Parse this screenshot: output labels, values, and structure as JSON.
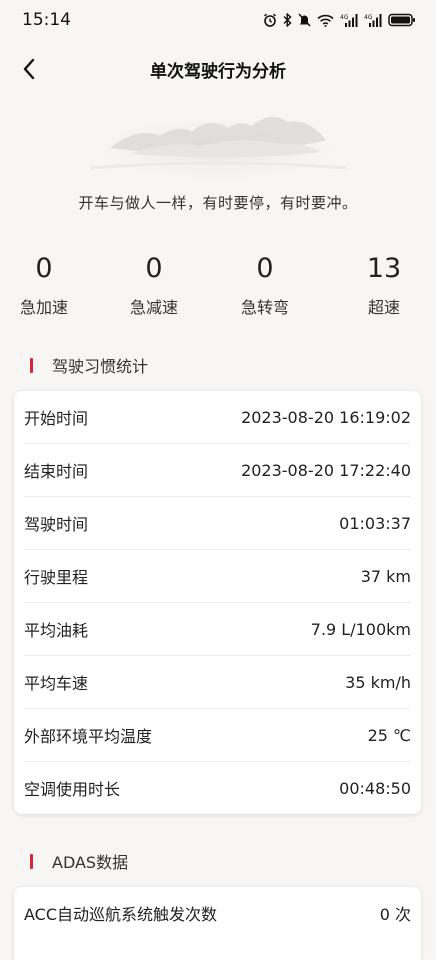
{
  "status_bar": {
    "time": "15:14",
    "icons": [
      "alarm-icon",
      "bluetooth-icon",
      "mute-icon",
      "wifi-icon",
      "signal-4g-icon",
      "signal-4g-icon",
      "battery-icon"
    ],
    "network_label": "4G"
  },
  "header": {
    "back_icon": "chevron-left-icon",
    "title": "单次驾驶行为分析"
  },
  "quote": "开车与做人一样，有时要停，有时要冲。",
  "stats": [
    {
      "value": "0",
      "label": "急加速"
    },
    {
      "value": "0",
      "label": "急减速"
    },
    {
      "value": "0",
      "label": "急转弯"
    },
    {
      "value": "13",
      "label": "超速"
    }
  ],
  "habits": {
    "title": "驾驶习惯统计",
    "rows": [
      {
        "label": "开始时间",
        "value": "2023-08-20 16:19:02"
      },
      {
        "label": "结束时间",
        "value": "2023-08-20 17:22:40"
      },
      {
        "label": "驾驶时间",
        "value": "01:03:37"
      },
      {
        "label": "行驶里程",
        "value": "37 km"
      },
      {
        "label": "平均油耗",
        "value": "7.9 L/100km"
      },
      {
        "label": "平均车速",
        "value": "35 km/h"
      },
      {
        "label": "外部环境平均温度",
        "value": "25 ℃"
      },
      {
        "label": "空调使用时长",
        "value": "00:48:50"
      }
    ]
  },
  "adas": {
    "title": "ADAS数据",
    "rows": [
      {
        "label": "ACC自动巡航系统触发次数",
        "value": "0 次"
      }
    ]
  },
  "colors": {
    "accent": "#d6263c",
    "background": "#f7f6f4",
    "card": "#ffffff"
  }
}
